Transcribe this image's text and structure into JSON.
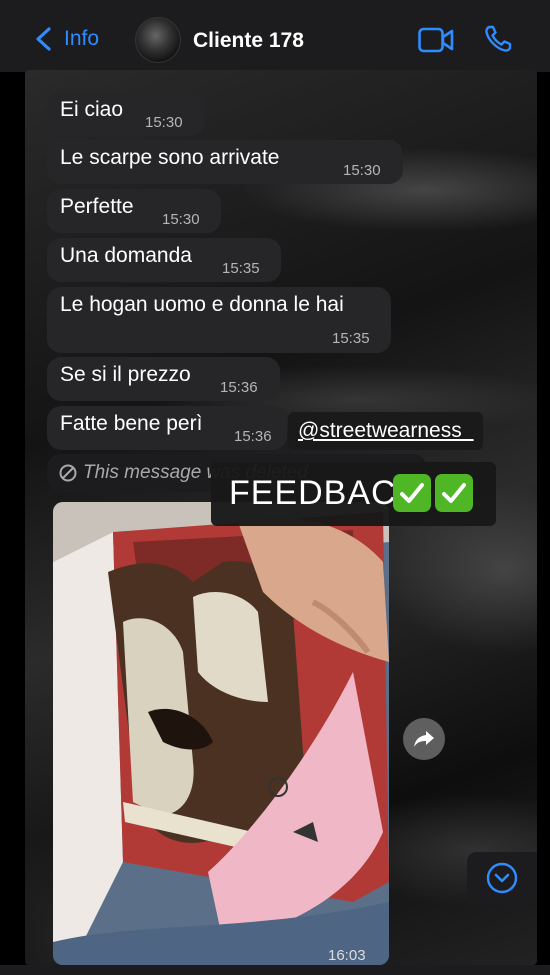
{
  "header": {
    "back_label": "Info",
    "contact_name": "Cliente 178"
  },
  "messages": [
    {
      "text": "Ei ciao",
      "time": "15:30"
    },
    {
      "text": "Le scarpe sono arrivate",
      "time": "15:30"
    },
    {
      "text": "Perfette",
      "time": "15:30"
    },
    {
      "text": "Una domanda",
      "time": "15:35"
    },
    {
      "text": "Le hogan uomo e donna le hai",
      "time": "15:35"
    },
    {
      "text": "Se si il prezzo",
      "time": "15:36"
    },
    {
      "text": "Fatte bene perì",
      "time": "15:36"
    }
  ],
  "deleted_message": "This message was deleted",
  "photo_message": {
    "time": "16:03"
  },
  "stickers": {
    "username": "@streetwearness_",
    "feedback": "FEEDBACK"
  },
  "colors": {
    "accent": "#2f8cff",
    "bubble": "#262628",
    "header": "#1c1c1e",
    "check_green": "#4fb626"
  },
  "icons": [
    "chevron-left-icon",
    "video-call-icon",
    "phone-icon",
    "blocked-icon",
    "forward-icon",
    "chevron-down-icon",
    "checkmark-icon"
  ]
}
